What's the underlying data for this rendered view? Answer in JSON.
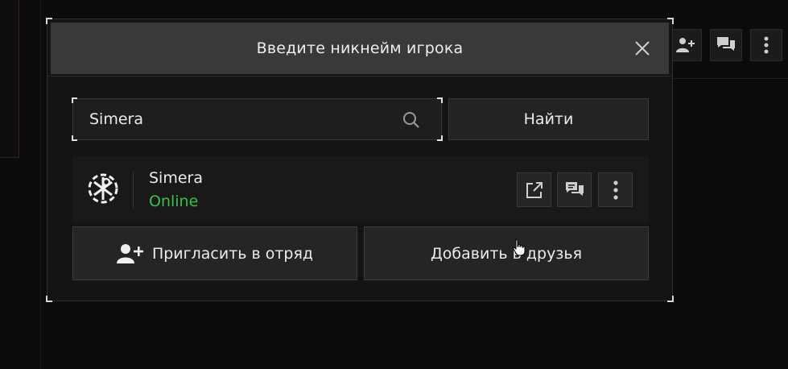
{
  "modal": {
    "title": "Введите никнейм игрока"
  },
  "search": {
    "value": "Simera",
    "find_label": "Найти"
  },
  "player": {
    "name": "Simera",
    "status": "Online",
    "status_color": "#35c24a"
  },
  "actions": {
    "invite_label": "Пригласить в отряд",
    "add_friend_label": "Добавить в друзья"
  },
  "icons": {
    "close": "close-icon",
    "search": "search-icon",
    "open_profile": "external-link-icon",
    "chat": "chat-icon",
    "more": "more-vertical-icon",
    "invite": "add-user-icon",
    "logo": "player-avatar-logo"
  }
}
